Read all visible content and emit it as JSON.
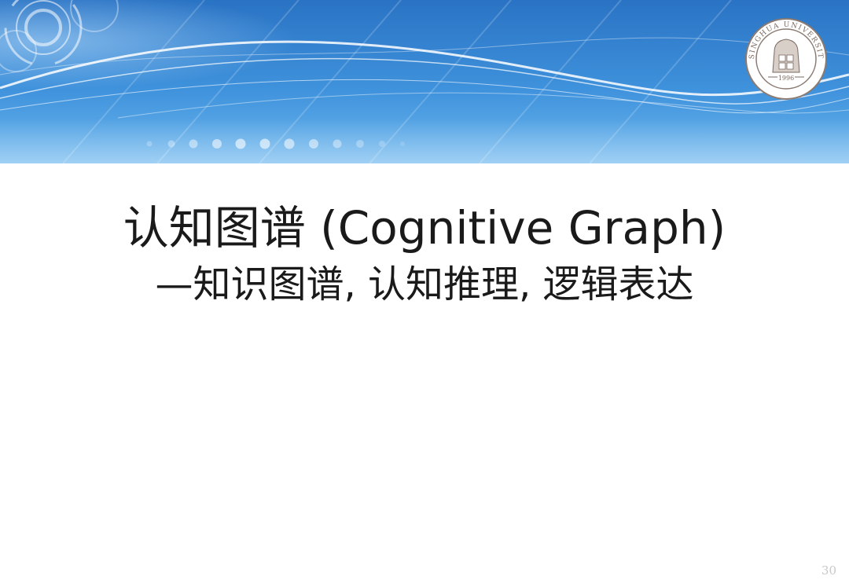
{
  "slide": {
    "title": "认知图谱 (Cognitive Graph)",
    "subtitle": "—知识图谱, 认知推理, 逻辑表达",
    "page_number": "30"
  },
  "logo": {
    "top_text": "TSINGHUA UNIVERSITY",
    "year": "1996"
  },
  "colors": {
    "banner_dark": "#1f67b8",
    "banner_light": "#5aa8e6",
    "text": "#1a1a1a",
    "page_number": "#c8c8c8"
  }
}
